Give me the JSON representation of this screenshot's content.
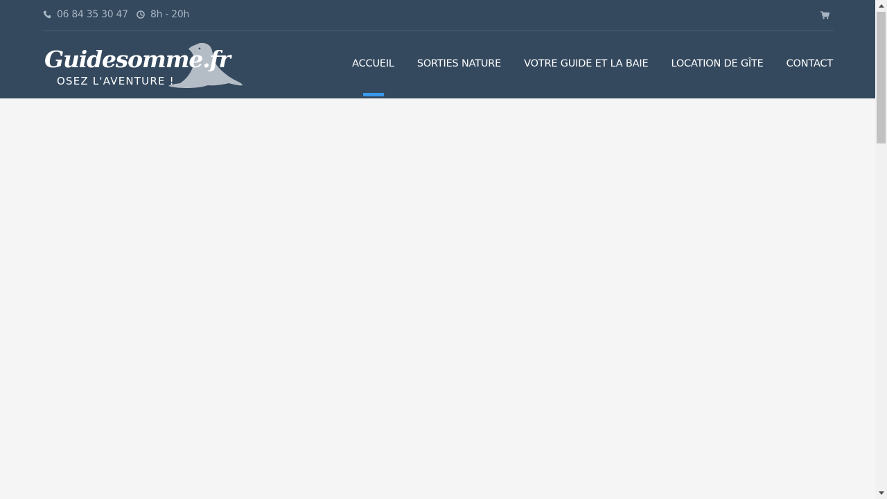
{
  "topbar": {
    "phone": "06 84 35 30 47",
    "hours": "8h - 20h",
    "icons": {
      "phone": "phone-icon",
      "hours": "clock-icon",
      "cart": "cart-icon"
    }
  },
  "logo": {
    "wordmark": "Guidesomme.fr",
    "tagline": "OSEZ L'AVENTURE !"
  },
  "nav": {
    "items": [
      {
        "label": "ACCUEIL"
      },
      {
        "label": "SORTIES NATURE"
      },
      {
        "label": "VOTRE GUIDE ET LA BAIE"
      },
      {
        "label": "LOCATION DE GÎTE"
      },
      {
        "label": "CONTACT"
      }
    ],
    "active_index": 0
  },
  "colors": {
    "header_bg": "#34495e",
    "accent": "#3b98ea",
    "page_bg": "#f5f5f5",
    "muted_text": "#a9b6c3"
  }
}
